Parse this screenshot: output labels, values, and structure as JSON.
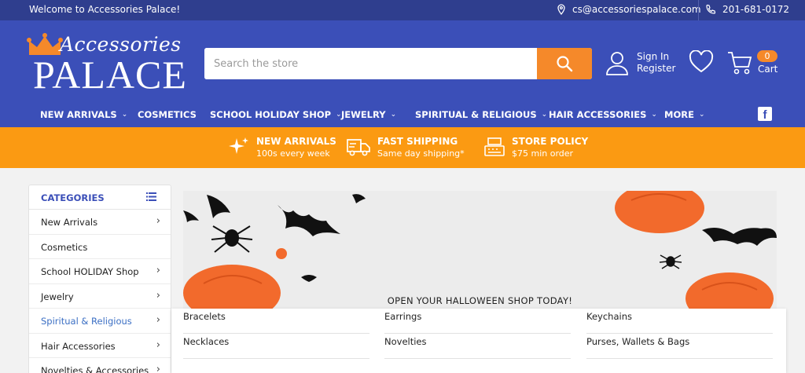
{
  "topbar": {
    "welcome": "Welcome to Accessories Palace!",
    "email": "cs@accessoriespalace.com",
    "phone": "201-681-0172"
  },
  "logo": {
    "script": "Accessories",
    "word": "PALACE"
  },
  "search": {
    "placeholder": "Search the store"
  },
  "account": {
    "sign_in": "Sign In",
    "register": "Register"
  },
  "cart": {
    "count": "0",
    "label": "Cart"
  },
  "nav": [
    {
      "label": "NEW ARRIVALS",
      "chevron": true
    },
    {
      "label": "COSMETICS",
      "chevron": false
    },
    {
      "label": "SCHOOL HOLIDAY SHOP",
      "chevron": true
    },
    {
      "label": "JEWELRY",
      "chevron": true
    },
    {
      "label": "SPIRITUAL & RELIGIOUS",
      "chevron": true
    },
    {
      "label": "HAIR ACCESSORIES",
      "chevron": true
    },
    {
      "label": "MORE",
      "chevron": true
    }
  ],
  "promo": [
    {
      "title": "NEW ARRIVALS",
      "sub": "100s every week",
      "icon": "sparkle-icon"
    },
    {
      "title": "FAST SHIPPING",
      "sub": "Same day shipping*",
      "icon": "truck-icon"
    },
    {
      "title": "STORE POLICY",
      "sub": "$75 min order",
      "icon": "register-icon"
    }
  ],
  "categories": {
    "title": "CATEGORIES",
    "items": [
      {
        "label": "New Arrivals",
        "arrow": true
      },
      {
        "label": "Cosmetics",
        "arrow": false
      },
      {
        "label": "School HOLIDAY Shop",
        "arrow": true
      },
      {
        "label": "Jewelry",
        "arrow": true
      },
      {
        "label": "Spiritual & Religious",
        "arrow": true
      },
      {
        "label": "Hair Accessories",
        "arrow": true
      },
      {
        "label": "Novelties & Accessories",
        "arrow": true
      }
    ]
  },
  "banner": {
    "caption": "OPEN YOUR HALLOWEEN SHOP TODAY!"
  },
  "dropdown": {
    "columns": [
      [
        "Bracelets",
        "Necklaces"
      ],
      [
        "Earrings",
        "Novelties"
      ],
      [
        "Keychains",
        "Purses, Wallets & Bags"
      ]
    ]
  },
  "colors": {
    "topbar": "#2f3e8e",
    "header": "#3b4fb8",
    "accent": "#f5892a",
    "promo": "#fb9a12",
    "active_link": "#3b6fc4"
  }
}
